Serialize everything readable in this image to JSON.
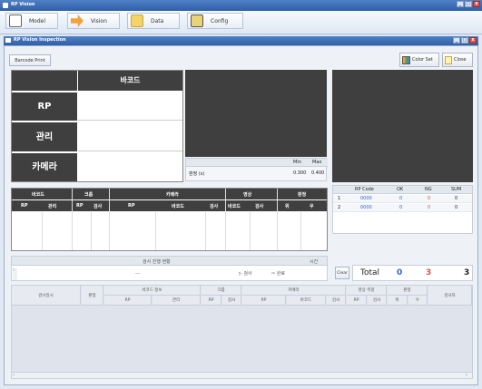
{
  "app": {
    "title": "RP Vision"
  },
  "toolbar": {
    "items": [
      {
        "label": "Model",
        "icon": "document-icon"
      },
      {
        "label": "Vision",
        "icon": "arrow-icon"
      },
      {
        "label": "Data",
        "icon": "folder-icon"
      },
      {
        "label": "Config",
        "icon": "config-icon"
      }
    ]
  },
  "child": {
    "title": "RP Vision Inspection",
    "barcode_print": "Barcode Print",
    "color_set": "Color Set",
    "close": "Close"
  },
  "info_table": {
    "header": "바코드",
    "rows": [
      "RP",
      "관리",
      "카메라"
    ]
  },
  "stats": {
    "headers": [
      "",
      "",
      "",
      "Min",
      "Max"
    ],
    "row_label": "판정 (s)",
    "min": "0.300",
    "max": "0.400"
  },
  "main_table": {
    "groups": [
      "바코드",
      "크롭",
      "카메라",
      "영상",
      "판정"
    ],
    "subs": [
      "RP",
      "관리",
      "RP",
      "검사",
      "RP",
      "바코드",
      "검사",
      "바코드",
      "검사",
      "위",
      "우"
    ]
  },
  "counter": {
    "headers": [
      "",
      "RP Code",
      "OK",
      "NG",
      "SUM"
    ],
    "rows": [
      {
        "idx": "1",
        "code": "0000",
        "ok": "0",
        "ng": "0",
        "sum": "0"
      },
      {
        "idx": "2",
        "code": "0000",
        "ok": "0",
        "ng": "0",
        "sum": "0"
      }
    ],
    "clear": "Clear",
    "total_label": "Total",
    "total_ok": "0",
    "total_ng": "3",
    "total_sum": "3"
  },
  "progress": {
    "header": "검사 진행 현황",
    "time_label": "시간",
    "center_text": "---",
    "next_label": "▷ 검사",
    "done_label": "⇨ 완료"
  },
  "log": {
    "top": [
      "검사일시",
      "판정",
      "바코드 정보",
      "크롭",
      "카메라",
      "영상 측정",
      "판정",
      "검사자"
    ],
    "sub": [
      "RP",
      "관리",
      "RP",
      "검사",
      "RP",
      "바코드",
      "검사",
      "RP",
      "검사",
      "위",
      "우"
    ]
  },
  "colors": {
    "title_bar": "#2f5fa8",
    "dark_panel": "#3f3f3f",
    "ng_red": "#d9534f",
    "ok_blue": "#3366cc"
  }
}
